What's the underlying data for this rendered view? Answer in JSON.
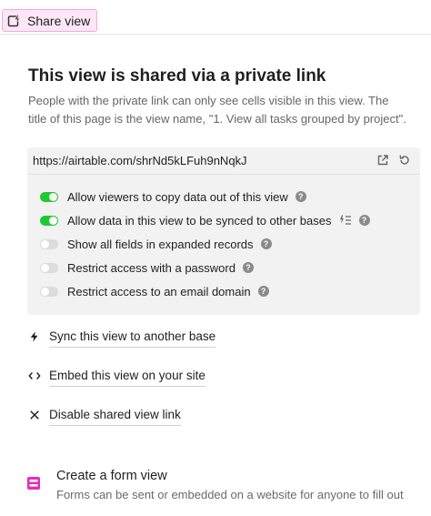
{
  "toolbar": {
    "share_label": "Share view",
    "accent_color": "#e929ba"
  },
  "panel": {
    "title": "This view is shared via a private link",
    "description": "People with the private link can only see cells visible in this view. The title of this page is the view name, \"1. View all tasks grouped by project\".",
    "url": "https://airtable.com/shrNd5kLFuh9nNqkJ",
    "options": [
      {
        "label": "Allow viewers to copy data out of this view",
        "enabled": true
      },
      {
        "label": "Allow data in this view to be synced to other bases",
        "enabled": true
      },
      {
        "label": "Show all fields in expanded records",
        "enabled": false
      },
      {
        "label": "Restrict access with a password",
        "enabled": false
      },
      {
        "label": "Restrict access to an email domain",
        "enabled": false
      }
    ],
    "toggle_on_color": "#20c933"
  },
  "actions": {
    "sync": {
      "label": "Sync this view to another base",
      "icon": "lightning-icon"
    },
    "embed": {
      "label": "Embed this view on your site",
      "icon": "code-icon"
    },
    "disable": {
      "label": "Disable shared view link",
      "icon": "close-icon"
    }
  },
  "form_view": {
    "title": "Create a form view",
    "description": "Forms can be sent or embedded on a website for anyone to fill out",
    "icon": "form-icon"
  }
}
